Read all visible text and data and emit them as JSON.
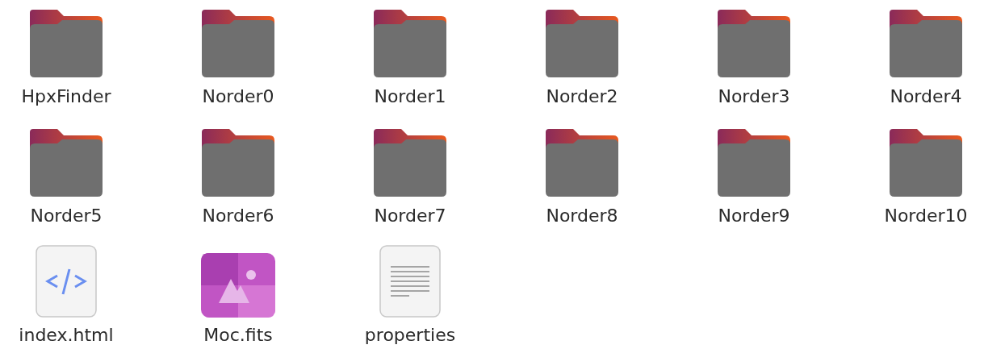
{
  "items": [
    {
      "name": "HpxFinder",
      "kind": "folder"
    },
    {
      "name": "Norder0",
      "kind": "folder"
    },
    {
      "name": "Norder1",
      "kind": "folder"
    },
    {
      "name": "Norder2",
      "kind": "folder"
    },
    {
      "name": "Norder3",
      "kind": "folder"
    },
    {
      "name": "Norder4",
      "kind": "folder"
    },
    {
      "name": "Norder5",
      "kind": "folder"
    },
    {
      "name": "Norder6",
      "kind": "folder"
    },
    {
      "name": "Norder7",
      "kind": "folder"
    },
    {
      "name": "Norder8",
      "kind": "folder"
    },
    {
      "name": "Norder9",
      "kind": "folder"
    },
    {
      "name": "Norder10",
      "kind": "folder"
    },
    {
      "name": "index.html",
      "kind": "html"
    },
    {
      "name": "Moc.fits",
      "kind": "image"
    },
    {
      "name": "properties",
      "kind": "text"
    }
  ]
}
